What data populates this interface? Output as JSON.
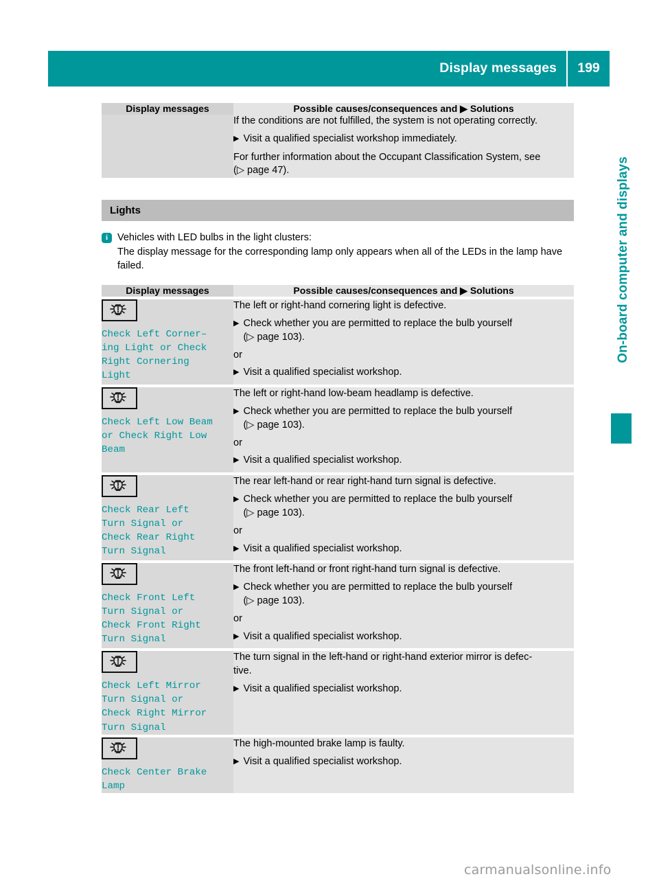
{
  "header": {
    "title": "Display messages",
    "page_number": "199",
    "accent_color": "#00979b"
  },
  "side_tab": {
    "label": "On-board computer and displays",
    "color": "#00979b"
  },
  "table_headers": {
    "left": "Display messages",
    "right_prefix": "Possible causes/consequences and",
    "right_arrow": "▶",
    "right_suffix": "Solutions"
  },
  "top_table": {
    "rows": [
      {
        "left_message": "",
        "lines": [
          {
            "kind": "text",
            "text": "If the conditions are not fulfilled, the system is not operating correctly."
          },
          {
            "kind": "step",
            "arrow": "▶",
            "text": "Visit a qualified specialist workshop immediately."
          },
          {
            "kind": "text",
            "text": "For further information about the Occupant Classification System, see"
          },
          {
            "kind": "text",
            "text": "(▷ page 47)."
          }
        ]
      }
    ]
  },
  "section": {
    "title": "Lights"
  },
  "note": {
    "icon": "info-icon",
    "icon_glyph": "i",
    "first_line": "Vehicles with LED bulbs in the light clusters:",
    "body": "The display message for the corresponding lamp only appears when all of the LEDs in the lamp have failed."
  },
  "lights_table": {
    "rows": [
      {
        "icon": "bulb-warning-icon",
        "message_parts": [
          {
            "type": "code",
            "text": "Check Left Corner–"
          },
          {
            "type": "code",
            "text": "ing Light "
          },
          {
            "type": "plain",
            "text": "or "
          },
          {
            "type": "code",
            "text": "Check"
          },
          {
            "type": "code",
            "text": "Right Cornering"
          },
          {
            "type": "code",
            "text": "Light"
          }
        ],
        "message_text": "Check Left Corner–ing Light or Check Right Cornering Light",
        "lines": [
          {
            "kind": "text",
            "text": "The left or right-hand cornering light is defective."
          },
          {
            "kind": "step",
            "arrow": "▶",
            "text": "Check whether you are permitted to replace the bulb yourself",
            "sub": "(▷ page 103)."
          },
          {
            "kind": "text",
            "text": "or"
          },
          {
            "kind": "step",
            "arrow": "▶",
            "text": "Visit a qualified specialist workshop."
          }
        ]
      },
      {
        "icon": "bulb-warning-icon",
        "message_text": "Check Left Low Beam or Check Right Low Beam",
        "lines": [
          {
            "kind": "text",
            "text": "The left or right-hand low-beam headlamp is defective."
          },
          {
            "kind": "step",
            "arrow": "▶",
            "text": "Check whether you are permitted to replace the bulb yourself",
            "sub": "(▷ page 103)."
          },
          {
            "kind": "text",
            "text": "or"
          },
          {
            "kind": "step",
            "arrow": "▶",
            "text": "Visit a qualified specialist workshop."
          }
        ]
      },
      {
        "icon": "bulb-warning-icon",
        "message_text": "Check Rear Left Turn Signal or Check Rear Right Turn Signal",
        "lines": [
          {
            "kind": "text",
            "text": "The rear left-hand or rear right-hand turn signal is defective."
          },
          {
            "kind": "step",
            "arrow": "▶",
            "text": "Check whether you are permitted to replace the bulb yourself",
            "sub": "(▷ page 103)."
          },
          {
            "kind": "text",
            "text": "or"
          },
          {
            "kind": "step",
            "arrow": "▶",
            "text": "Visit a qualified specialist workshop."
          }
        ]
      },
      {
        "icon": "bulb-warning-icon",
        "message_text": "Check Front Left Turn Signal or Check Front Right Turn Signal",
        "lines": [
          {
            "kind": "text",
            "text": "The front left-hand or front right-hand turn signal is defective."
          },
          {
            "kind": "step",
            "arrow": "▶",
            "text": "Check whether you are permitted to replace the bulb yourself",
            "sub": "(▷ page 103)."
          },
          {
            "kind": "text",
            "text": "or"
          },
          {
            "kind": "step",
            "arrow": "▶",
            "text": "Visit a qualified specialist workshop."
          }
        ]
      },
      {
        "icon": "bulb-warning-icon",
        "message_text": "Check Left Mirror Turn Signal or Check Right Mirror Turn Signal",
        "lines": [
          {
            "kind": "text",
            "text": "The turn signal in the left-hand or right-hand exterior mirror is defec-"
          },
          {
            "kind": "text",
            "text": "tive."
          },
          {
            "kind": "step",
            "arrow": "▶",
            "text": "Visit a qualified specialist workshop."
          }
        ]
      },
      {
        "icon": "bulb-warning-icon",
        "message_text": "Check Center Brake Lamp",
        "lines": [
          {
            "kind": "text",
            "text": "The high-mounted brake lamp is faulty."
          },
          {
            "kind": "step",
            "arrow": "▶",
            "text": "Visit a qualified specialist workshop."
          }
        ]
      }
    ]
  },
  "watermark": {
    "text": "carmanualsonline.info"
  },
  "message_lines": {
    "row0": [
      "Check Left Corner–",
      "ing Light  or  Check",
      "Right Cornering",
      "Light"
    ],
    "row1": [
      "Check Left Low Beam",
      "or  Check Right Low",
      "Beam"
    ],
    "row2": [
      "Check Rear Left",
      "Turn Signal  or",
      "Check Rear Right",
      "Turn Signal"
    ],
    "row3": [
      "Check Front Left",
      "Turn Signal  or",
      "Check Front Right",
      "Turn Signal"
    ],
    "row4": [
      "Check Left Mirror",
      "Turn Signal  or",
      "Check Right Mirror",
      "Turn Signal"
    ],
    "row5": [
      "Check Center Brake",
      "Lamp"
    ]
  }
}
